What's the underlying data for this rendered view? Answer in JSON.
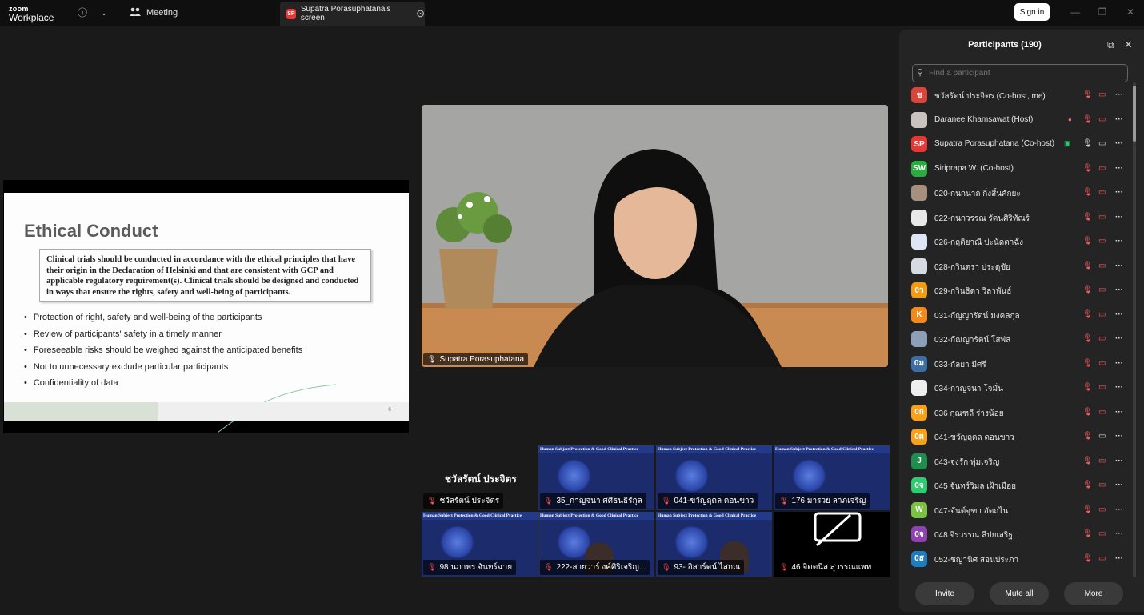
{
  "app": {
    "brand_small": "zoom",
    "brand_large": "Workplace"
  },
  "titlebar": {
    "meeting_label": "Meeting",
    "share_tab_badge": "SP",
    "share_tab_label": "Supatra Porasuphatana's screen",
    "signin_label": "Sign in"
  },
  "slide": {
    "title": "Ethical Conduct",
    "box_text": "Clinical trials should be conducted in accordance with the ethical principles that have their origin in the Declaration of Helsinki and that are consistent with GCP and applicable regulatory requirement(s).  Clinical trials should be designed and conducted in ways that ensure the rights, safety and well-being of participants.",
    "bullets": [
      "Protection of right, safety and well-being of the participants",
      "Review of participants' safety in a timely manner",
      "Foreseeable risks should be weighed against the anticipated benefits",
      "Not to unnecessary exclude particular participants",
      "Confidentiality of data"
    ],
    "page_number": "6"
  },
  "main_video": {
    "name": "Supatra Porasuphatana"
  },
  "gallery": {
    "banner": "Human Subject Protection & Good Clinical Practice",
    "name_only_display": "ชวัลรัตน์ ประจิตร",
    "tiles": [
      {
        "name": "ชวัลรัตน์ ประจิตร"
      },
      {
        "name": "35_กาญจนา ศศิธนธิรักุล"
      },
      {
        "name": "041-ขวัญฤดล ดอนขาว"
      },
      {
        "name": "176 มารวย ลาภเจริญ"
      },
      {
        "name": "98 นภาพร จันทร์ฉาย"
      },
      {
        "name": "222-สายวาร์ งค์ศิริเจริญ..."
      },
      {
        "name": "93- อิสาร์ตน์ ไสกณ"
      },
      {
        "name": "46 จิตตนิส สุวรรณแพท"
      }
    ]
  },
  "participants_panel": {
    "title": "Participants (190)",
    "search_placeholder": "Find a participant",
    "participants": [
      {
        "name": "ชวัลรัตน์ ประจิตร (Co-host, me)",
        "avatar": "ช",
        "color": "#d9453b"
      },
      {
        "name": "Daranee Khamsawat (Host)",
        "avatar": "",
        "color": "#c9c2bd"
      },
      {
        "name": "Supatra Porasuphatana (Co-host)",
        "avatar": "SP",
        "color": "#e53935"
      },
      {
        "name": "Siriprapa W. (Co-host)",
        "avatar": "SW",
        "color": "#27ae3f"
      },
      {
        "name": "020-กนกนาถ กิ่งสิ้นศักยะ",
        "avatar": "",
        "color": "#a58f7d"
      },
      {
        "name": "022-กนกวรรณ รัตนศิริทัณร์",
        "avatar": "",
        "color": "#e8e8e8"
      },
      {
        "name": "026-กฤติยาณี ปะนัดตาฉั่ง",
        "avatar": "",
        "color": "#dfe6f3"
      },
      {
        "name": "028-กวินตรา ประดุชัย",
        "avatar": "",
        "color": "#d6dbe3"
      },
      {
        "name": "029-กวินธิดา วิลาพันธ์",
        "avatar": "0ว",
        "color": "#f39c12"
      },
      {
        "name": "031-กัญญารัตน์ มงคลกุล",
        "avatar": "K",
        "color": "#f08a1c"
      },
      {
        "name": "032-กัณญารัตน์ โสฬส",
        "avatar": "",
        "color": "#8d9fb8"
      },
      {
        "name": "033-กัลยา มีศรี",
        "avatar": "0ม",
        "color": "#3a6ea5"
      },
      {
        "name": "034-กาญจนา โจมั่น",
        "avatar": "",
        "color": "#eeeeee"
      },
      {
        "name": "036 กุณฑลี ร่างน้อย",
        "avatar": "0ก",
        "color": "#f5a21a"
      },
      {
        "name": "041-ขวัญฤดล ดอนขาว",
        "avatar": "0ผ",
        "color": "#f5a21a"
      },
      {
        "name": "043-จงรัก พุ่มเจริญ",
        "avatar": "J",
        "color": "#1e8e4e"
      },
      {
        "name": "045 จันทร์วิมล เฝ้าเมื่อย",
        "avatar": "0จ",
        "color": "#2ecc71"
      },
      {
        "name": "047-จันต์จุฑา อัตถไน",
        "avatar": "W",
        "color": "#7cc242"
      },
      {
        "name": "048 จิรวรรณ ลีปยเสริฐ",
        "avatar": "0จ",
        "color": "#8e44ad"
      },
      {
        "name": "052-ชญานิศ สอนประภา",
        "avatar": "0ส",
        "color": "#1f7dbf"
      }
    ],
    "buttons": {
      "invite": "Invite",
      "mute_all": "Mute all",
      "more": "More"
    }
  }
}
